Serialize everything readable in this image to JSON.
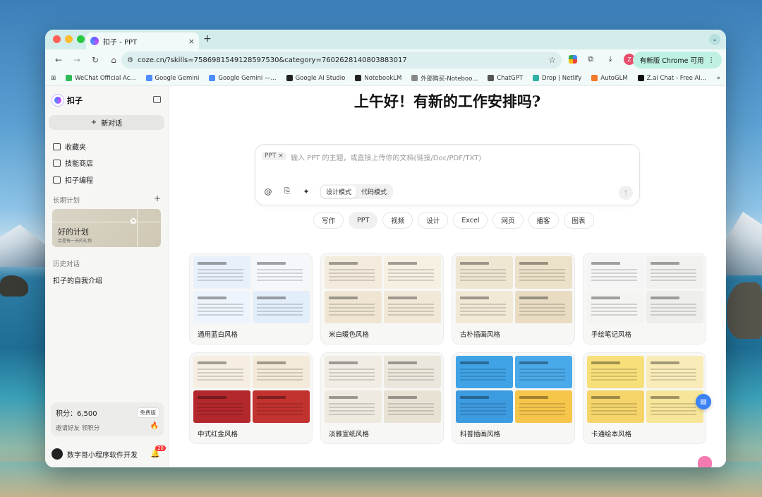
{
  "browser": {
    "tab_title": "扣子 - PPT",
    "tab_close": "×",
    "new_tab": "+",
    "url": "coze.cn/?skills=7586981549128597530&category=7602628140803883017",
    "profile_initial": "Z",
    "update_label": "有新版 Chrome 可用",
    "bookmarks": [
      {
        "label": "WeChat Official Ac...",
        "color": "#2dbb5a"
      },
      {
        "label": "Google Gemini",
        "color": "#4d8dff"
      },
      {
        "label": "Google Gemini —...",
        "color": "#4d8dff"
      },
      {
        "label": "Google AI Studio",
        "color": "#222222"
      },
      {
        "label": "NotebookLM",
        "color": "#222222"
      },
      {
        "label": "外部购买-Noteboo...",
        "color": "#888888"
      },
      {
        "label": "ChatGPT",
        "color": "#555555"
      },
      {
        "label": "Drop | Netlify",
        "color": "#2bb3a3"
      },
      {
        "label": "AutoGLM",
        "color": "#f07a2a"
      },
      {
        "label": "Z.ai Chat - Free AI...",
        "color": "#111111"
      }
    ]
  },
  "sidebar": {
    "brand": "扣子",
    "new_chat": "新对话",
    "links": [
      "收藏夹",
      "技能商店",
      "扣子编程"
    ],
    "long_term_label": "长期计划",
    "plan_card": {
      "title": "好的计划",
      "subtitle": "会是每一天的礼物"
    },
    "history_label": "历史对话",
    "history_items": [
      "扣子的自我介绍"
    ],
    "points": "积分：6,500",
    "free_badge": "免费版",
    "invite": "邀请好友 领积分",
    "username": "数字哥小程序软件开发",
    "notif_count": "20"
  },
  "main": {
    "greeting": "上午好！有新的工作安排吗?",
    "composer": {
      "chip": "PPT ×",
      "placeholder": "输入 PPT 的主题，或直接上传你的文档(链接/Doc/PDF/TXT)",
      "modes": [
        "设计模式",
        "代码模式"
      ]
    },
    "categories": [
      "写作",
      "PPT",
      "视频",
      "设计",
      "Excel",
      "网页",
      "播客",
      "图表"
    ],
    "active_category": "PPT",
    "templates": [
      {
        "label": "通用蓝白风格",
        "colors": [
          "#e8f1fb",
          "#f4f8fd",
          "#eef4fc",
          "#e3eefb"
        ]
      },
      {
        "label": "米白暖色风格",
        "colors": [
          "#f3ebdc",
          "#f6f0e3",
          "#efe5d2",
          "#f1e8d8"
        ]
      },
      {
        "label": "古朴插画风格",
        "colors": [
          "#efe6d2",
          "#ece1c9",
          "#f1e8d6",
          "#e9dcc2"
        ]
      },
      {
        "label": "手绘笔记风格",
        "colors": [
          "#f5f5f5",
          "#f1f1ef",
          "#f4f4f2",
          "#eeeeec"
        ]
      },
      {
        "label": "中式红金风格",
        "colors": [
          "#f6eee2",
          "#f3ead9",
          "#b3282d",
          "#c2322f"
        ]
      },
      {
        "label": "淡雅宣纸风格",
        "colors": [
          "#f1ede4",
          "#ece7dc",
          "#efeadf",
          "#e8e2d5"
        ]
      },
      {
        "label": "科普插画风格",
        "colors": [
          "#3fa3e6",
          "#4aa9e9",
          "#3d9be0",
          "#f6c64a"
        ]
      },
      {
        "label": "卡通绘本风格",
        "colors": [
          "#f7df7a",
          "#f9ecb8",
          "#f5d46a",
          "#f7e59a"
        ]
      }
    ]
  }
}
